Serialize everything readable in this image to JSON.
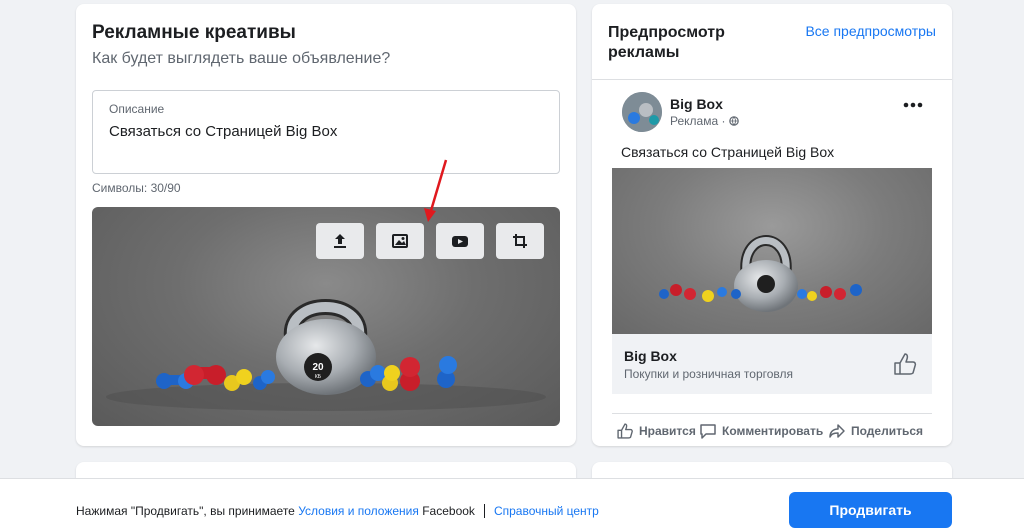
{
  "creative": {
    "title": "Рекламные креативы",
    "subtitle": "Как будет выглядеть ваше объявление?",
    "description_label": "Описание",
    "description_value": "Связаться со Страницей Big Box",
    "char_count": "Символы: 30/90",
    "media_buttons": [
      "upload-icon",
      "image-gallery-icon",
      "video-icon",
      "crop-icon"
    ],
    "kettlebell_label": "20",
    "kettlebell_unit": "КБ"
  },
  "preview": {
    "title": "Предпросмотр рекламы",
    "all_previews": "Все предпросмотры",
    "page_name": "Big Box",
    "sponsored": "Реклама ·",
    "post_text": "Связаться со Страницей Big Box",
    "link_title": "Big Box",
    "link_subtitle": "Покупки и розничная торговля",
    "actions": {
      "like": "Нравится",
      "comment": "Комментировать",
      "share": "Поделиться"
    }
  },
  "footer": {
    "prefix": "Нажимая \"Продвигать\", вы принимаете ",
    "terms_link": "Условия и положения",
    "suffix": " Facebook",
    "help_link": "Справочный центр",
    "promote_button": "Продвигать"
  },
  "colors": {
    "accent": "#1877f2",
    "annotation_arrow": "#e0191e"
  }
}
